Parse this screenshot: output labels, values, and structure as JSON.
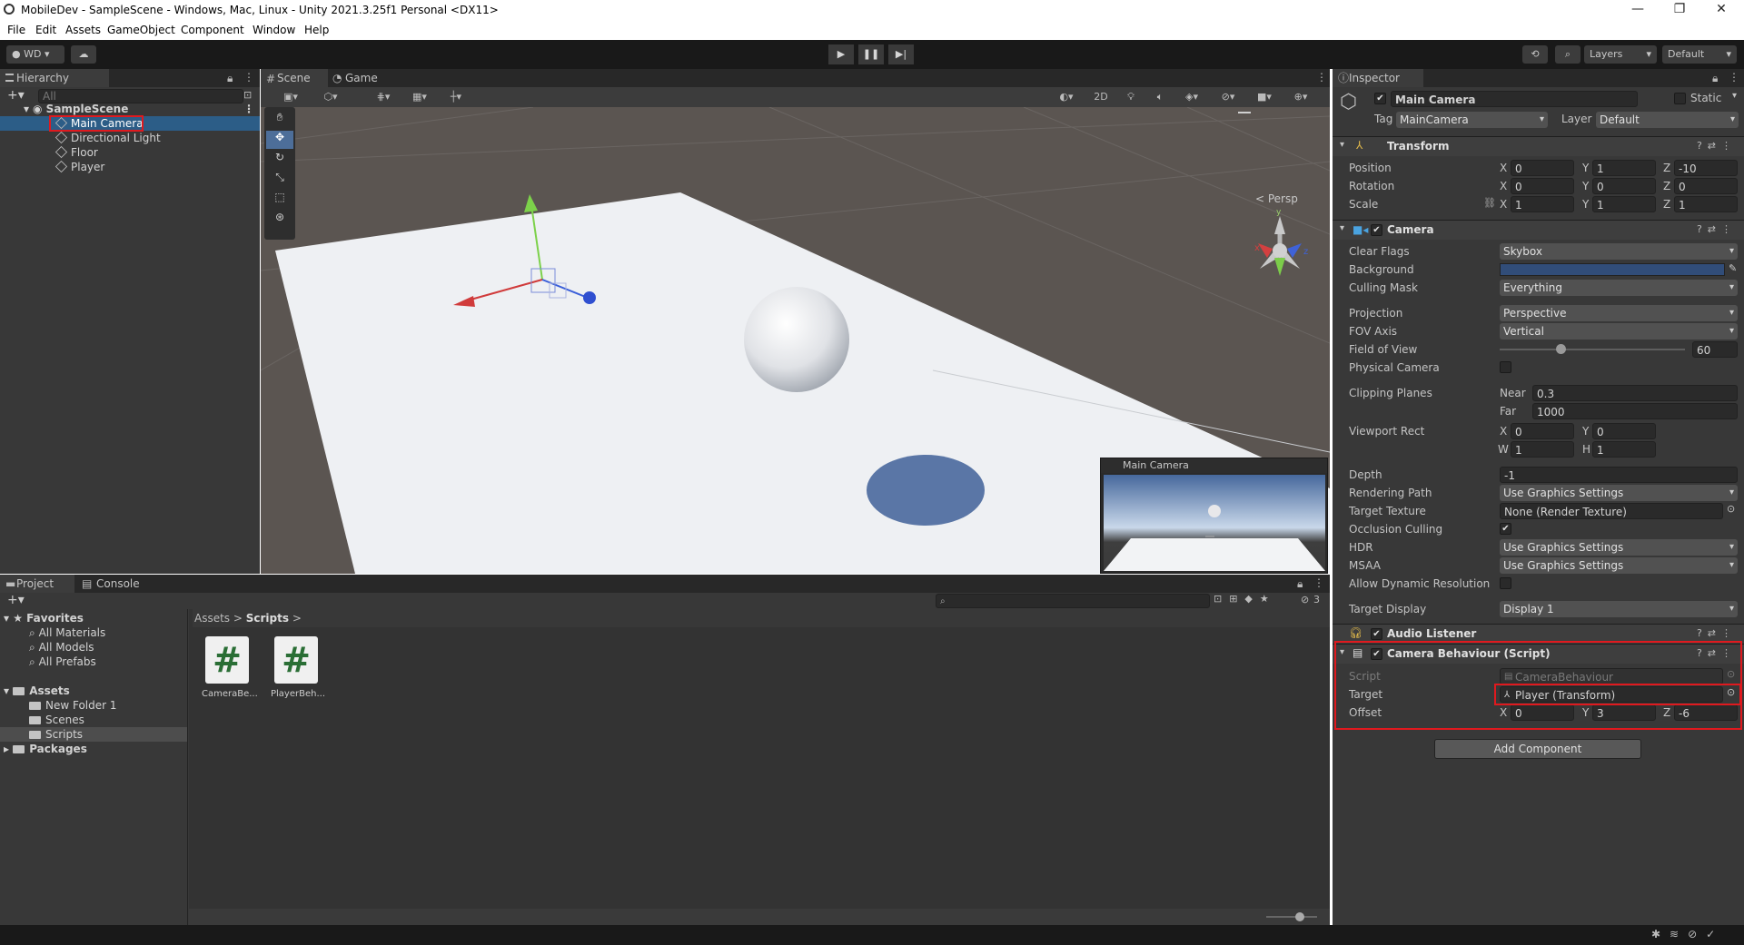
{
  "window": {
    "title": "MobileDev - SampleScene - Windows, Mac, Linux - Unity 2021.3.25f1 Personal <DX11>",
    "controls": [
      "—",
      "❐",
      "✕"
    ]
  },
  "menu": [
    "File",
    "Edit",
    "Assets",
    "GameObject",
    "Component",
    "Window",
    "Help"
  ],
  "toolbar": {
    "account": "WD",
    "layers": "Layers",
    "layout": "Default"
  },
  "hierarchy": {
    "tab": "Hierarchy",
    "search_placeholder": "All",
    "scene": "SampleScene",
    "items": [
      "Main Camera",
      "Directional Light",
      "Floor",
      "Player"
    ]
  },
  "scene_view": {
    "tabs": [
      "Scene",
      "Game"
    ],
    "mode_2d": "2D",
    "persp_label": "< Persp",
    "camera_preview_title": "Main Camera"
  },
  "inspector": {
    "tab": "Inspector",
    "object_name": "Main Camera",
    "static_label": "Static",
    "tag_label": "Tag",
    "tag_value": "MainCamera",
    "layer_label": "Layer",
    "layer_value": "Default",
    "transform": {
      "title": "Transform",
      "position": {
        "label": "Position",
        "x": "0",
        "y": "1",
        "z": "-10"
      },
      "rotation": {
        "label": "Rotation",
        "x": "0",
        "y": "0",
        "z": "0"
      },
      "scale": {
        "label": "Scale",
        "x": "1",
        "y": "1",
        "z": "1"
      }
    },
    "camera": {
      "title": "Camera",
      "clear_flags": {
        "label": "Clear Flags",
        "value": "Skybox"
      },
      "background": {
        "label": "Background",
        "color": "#314d79"
      },
      "culling_mask": {
        "label": "Culling Mask",
        "value": "Everything"
      },
      "projection": {
        "label": "Projection",
        "value": "Perspective"
      },
      "fov_axis": {
        "label": "FOV Axis",
        "value": "Vertical"
      },
      "field_of_view": {
        "label": "Field of View",
        "value": "60",
        "slider_fraction": 0.33
      },
      "physical_camera": {
        "label": "Physical Camera"
      },
      "clipping": {
        "label": "Clipping Planes",
        "near_label": "Near",
        "near": "0.3",
        "far_label": "Far",
        "far": "1000"
      },
      "viewport": {
        "label": "Viewport Rect",
        "x": "0",
        "y": "0",
        "w": "1",
        "h": "1"
      },
      "depth": {
        "label": "Depth",
        "value": "-1"
      },
      "rendering_path": {
        "label": "Rendering Path",
        "value": "Use Graphics Settings"
      },
      "target_texture": {
        "label": "Target Texture",
        "value": "None (Render Texture)"
      },
      "occlusion": {
        "label": "Occlusion Culling"
      },
      "hdr": {
        "label": "HDR",
        "value": "Use Graphics Settings"
      },
      "msaa": {
        "label": "MSAA",
        "value": "Use Graphics Settings"
      },
      "dynamic_res": {
        "label": "Allow Dynamic Resolution"
      },
      "target_display": {
        "label": "Target Display",
        "value": "Display 1"
      }
    },
    "audio_listener": {
      "title": "Audio Listener"
    },
    "camera_behaviour": {
      "title": "Camera Behaviour (Script)",
      "script_label": "Script",
      "script_value": "CameraBehaviour",
      "target_label": "Target",
      "target_value": "Player (Transform)",
      "offset_label": "Offset",
      "offset": {
        "x": "0",
        "y": "3",
        "z": "-6"
      }
    },
    "add_component": "Add Component"
  },
  "project": {
    "tabs": [
      "Project",
      "Console"
    ],
    "favorites": "Favorites",
    "fav_items": [
      "All Materials",
      "All Models",
      "All Prefabs"
    ],
    "assets": "Assets",
    "asset_folders": [
      "New Folder 1",
      "Scenes",
      "Scripts"
    ],
    "packages": "Packages",
    "breadcrumb": [
      "Assets",
      "Scripts"
    ],
    "files": [
      "CameraBe...",
      "PlayerBeh..."
    ],
    "hidden_count": "3"
  },
  "colors": {
    "selection": "#2c5d87",
    "highlight": "#e0191e"
  }
}
